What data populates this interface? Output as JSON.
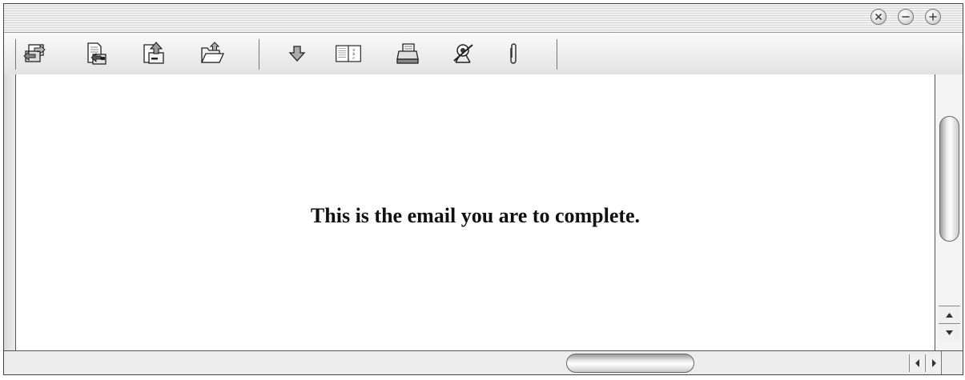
{
  "window": {
    "controls": [
      {
        "name": "close-icon",
        "glyph": "×"
      },
      {
        "name": "minimize-icon",
        "glyph": "−"
      },
      {
        "name": "zoom-icon",
        "glyph": "+"
      }
    ]
  },
  "toolbar": {
    "buttons": [
      {
        "icon": "send-receive-icon"
      },
      {
        "icon": "reply-icon"
      },
      {
        "icon": "forward-icon"
      },
      {
        "icon": "open-folder-icon"
      },
      {
        "icon": "download-icon"
      },
      {
        "icon": "address-book-icon"
      },
      {
        "icon": "print-icon"
      },
      {
        "icon": "junk-icon"
      },
      {
        "icon": "attachment-icon"
      }
    ]
  },
  "message": {
    "body": "This is the email you are to complete."
  }
}
